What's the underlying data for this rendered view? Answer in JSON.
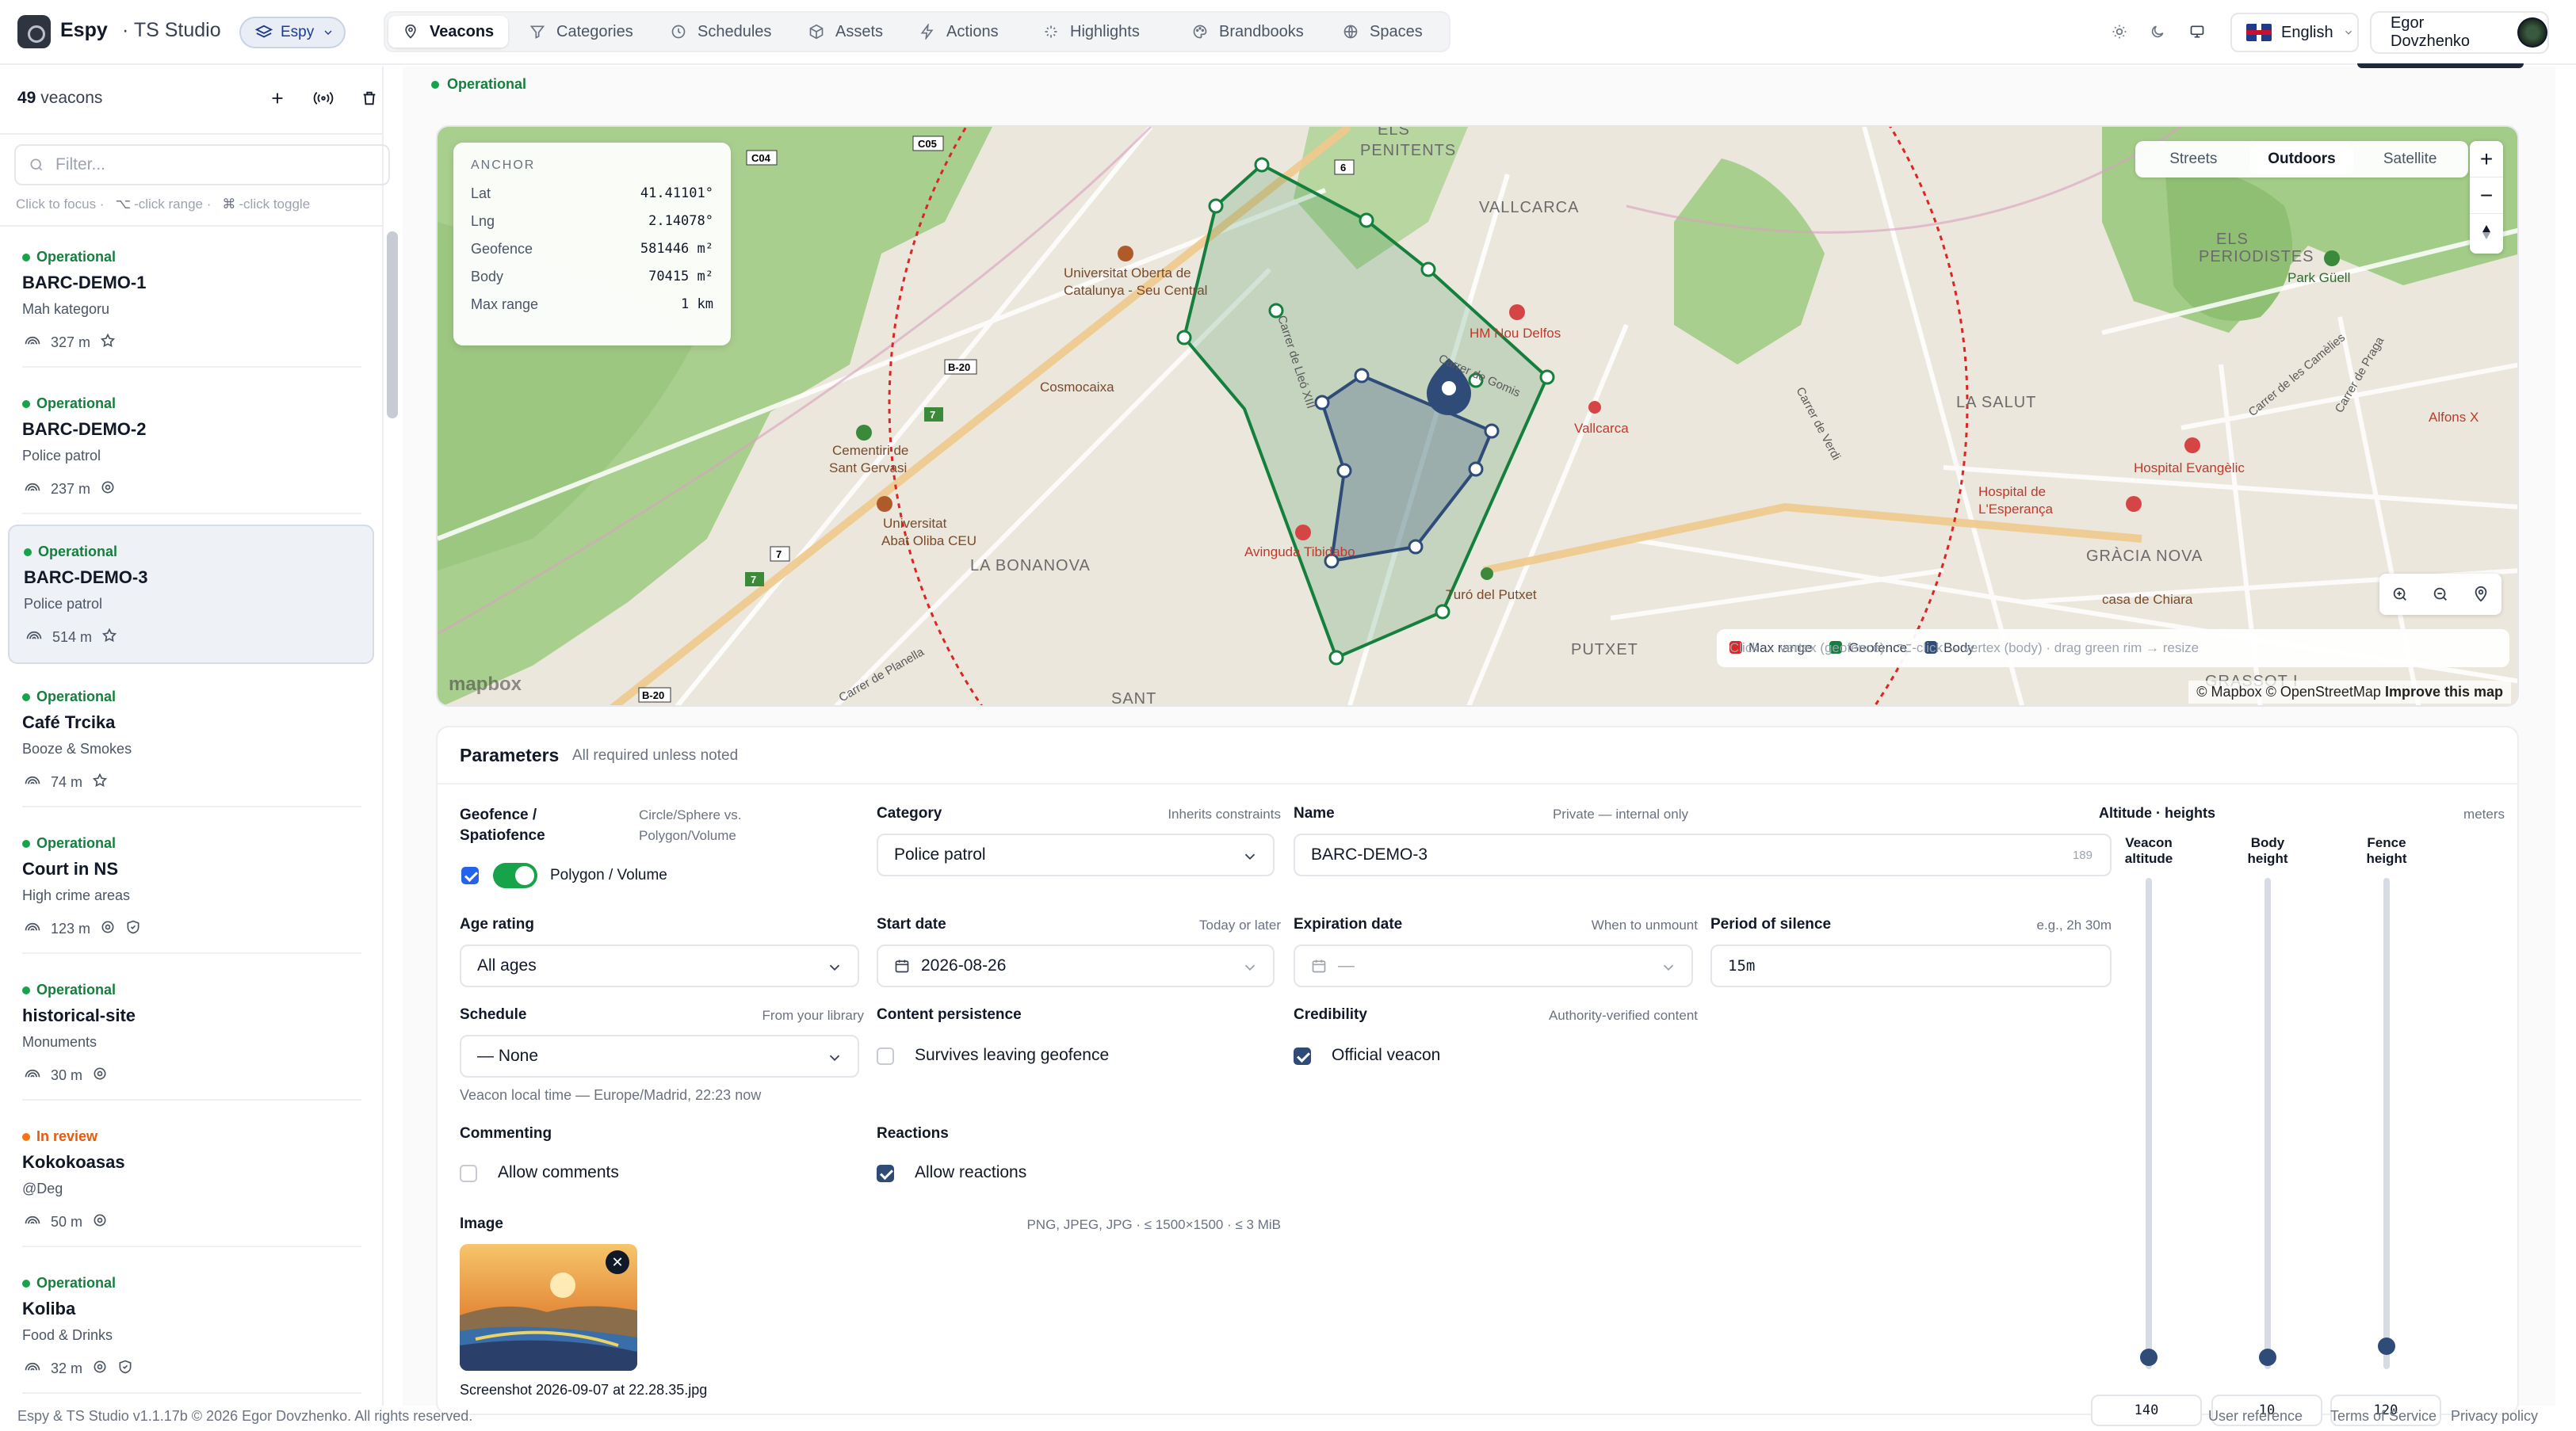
{
  "app": {
    "name": "Espy",
    "studio": "· TS Studio",
    "org": "Espy"
  },
  "nav": [
    {
      "label": "Veacons",
      "icon": "pin-icon",
      "active": true
    },
    {
      "label": "Categories",
      "icon": "filter-icon"
    },
    {
      "label": "Schedules",
      "icon": "clock-icon"
    },
    {
      "label": "Assets",
      "icon": "box-icon"
    },
    {
      "label": "Actions",
      "icon": "bolt-icon"
    },
    {
      "label": "Highlights",
      "icon": "sparkle-icon"
    },
    {
      "label": "Brandbooks",
      "icon": "palette-icon"
    },
    {
      "label": "Spaces",
      "icon": "globe-icon"
    }
  ],
  "header": {
    "language": "English",
    "user": "Egor Dovzhenko"
  },
  "sidebar": {
    "count": "49",
    "count_suffix": " veacons",
    "filter_placeholder": "Filter...",
    "hint_focus": "Click to focus ·",
    "hint_range": "-click range ·",
    "hint_toggle": "-click toggle",
    "items": [
      {
        "status": "Operational",
        "name": "BARC-DEMO-1",
        "category": "Mah kategoru",
        "range": "327 m",
        "badge": "star-icon"
      },
      {
        "status": "Operational",
        "name": "BARC-DEMO-2",
        "category": "Police patrol",
        "range": "237 m",
        "badge": "target-icon"
      },
      {
        "status": "Operational",
        "name": "BARC-DEMO-3",
        "category": "Police patrol",
        "range": "514 m",
        "badge": "star-icon"
      },
      {
        "status": "Operational",
        "name": "Café Trcika",
        "category": "Booze & Smokes",
        "range": "74 m",
        "badge": "star-icon"
      },
      {
        "status": "Operational",
        "name": "Court in NS",
        "category": "High crime areas",
        "range": "123 m",
        "badge": "target-icon"
      },
      {
        "status": "Operational",
        "name": "historical-site",
        "category": "Monuments",
        "range": "30 m",
        "badge": "target-icon"
      },
      {
        "status": "In review",
        "name": "Kokokoasas",
        "category": "@Deg",
        "range": "50 m",
        "badge": "target-icon"
      },
      {
        "status": "Operational",
        "name": "Koliba",
        "category": "Food & Drinks",
        "range": "32 m",
        "badge": "target-icon"
      }
    ]
  },
  "footer": {
    "copyright": "Espy & TS Studio v1.1.17b © 2026 Egor Dovzhenko. All rights reserved.",
    "links": [
      "User reference",
      "Terms of Service",
      "Privacy policy"
    ]
  },
  "veacon_status": "Operational",
  "map": {
    "anchor": {
      "title": "ANCHOR",
      "rows": [
        {
          "k": "Lat",
          "v": "41.41101°"
        },
        {
          "k": "Lng",
          "v": "2.14078°"
        },
        {
          "k": "Geofence",
          "v": "581446 m²"
        },
        {
          "k": "Body",
          "v": "70415 m²"
        },
        {
          "k": "Max range",
          "v": "1 km"
        }
      ]
    },
    "styles": [
      "Streets",
      "Outdoors",
      "Satellite"
    ],
    "active_style": "Outdoors",
    "legend": {
      "max_range": "Max range",
      "geofence": "Geofence",
      "body": "Body",
      "hint": "Click → vertex (geofence) · ⌥-click → vertex (body) · drag green rim → resize"
    },
    "colors": {
      "max_range": "#dc2626",
      "geofence": "#15803d",
      "body": "#2f4b78"
    },
    "attribution": "© Mapbox © OpenStreetMap",
    "improve": "Improve this map",
    "logo": "mapbox",
    "labels": [
      "ELS PENITENTS",
      "VALLCARCA",
      "ELS PERIODISTES",
      "LA SALUT",
      "GRÀCIA NOVA",
      "LA BONANOVA",
      "PUTXET",
      "SANT",
      "GRASSOT I",
      "Park Güell",
      "HM Nou Delfos",
      "Universitat Oberta de Catalunya - Seu Central",
      "Cosmocaixa",
      "Cementiri de Sant Gervasi",
      "Universitat Abat Oliba CEU",
      "Avinguda Tibidabo",
      "Turó del Putxet",
      "Vallcarca",
      "Hospital Evangèlic",
      "Hospital de L'Esperança",
      "casa de Chiara",
      "Alfons X",
      "Carrer de Lleó XIII",
      "Carrer de Gomis",
      "Carrer de les Camèlies",
      "Carrer de Praga",
      "Carrer de Verdi",
      "Carrer de Planella",
      "C05",
      "C04",
      "B-20",
      "6",
      "7"
    ]
  },
  "params": {
    "title": "Parameters",
    "subtitle": "All required unless noted",
    "geofence": {
      "label": "Geofence / Spatiofence",
      "hint": "Circle/Sphere vs. Polygon/Volume",
      "value": "Polygon / Volume"
    },
    "category": {
      "label": "Category",
      "hint": "Inherits constraints",
      "value": "Police patrol"
    },
    "name": {
      "label": "Name",
      "hint": "Private — internal only",
      "value": "BARC-DEMO-3",
      "remaining": "189"
    },
    "age": {
      "label": "Age rating",
      "value": "All ages"
    },
    "start": {
      "label": "Start date",
      "hint": "Today or later",
      "value": "2026-08-26"
    },
    "expiration": {
      "label": "Expiration date",
      "hint": "When to unmount",
      "value": "—"
    },
    "silence": {
      "label": "Period of silence",
      "hint": "e.g., 2h 30m",
      "value": "15m"
    },
    "schedule": {
      "label": "Schedule",
      "hint": "From your library",
      "value": "— None",
      "local_time": "Veacon local time — Europe/Madrid, 22:23 now"
    },
    "persistence": {
      "label": "Content persistence",
      "option": "Survives leaving geofence",
      "checked": false
    },
    "credibility": {
      "label": "Credibility",
      "hint": "Authority-verified content",
      "option": "Official veacon",
      "checked": true
    },
    "commenting": {
      "label": "Commenting",
      "option": "Allow comments",
      "checked": false
    },
    "reactions": {
      "label": "Reactions",
      "option": "Allow reactions",
      "checked": true
    },
    "image": {
      "label": "Image",
      "hint": "PNG, JPEG, JPG · ≤ 1500×1500 · ≤ 3 MiB",
      "filename": "Screenshot 2026-09-07 at 22.28.35.jpg"
    },
    "altitude": {
      "label": "Altitude · heights",
      "unit": "meters",
      "cols": [
        "Veacon altitude",
        "Body height",
        "Fence height"
      ],
      "values": [
        "140",
        "10",
        "120"
      ]
    }
  }
}
